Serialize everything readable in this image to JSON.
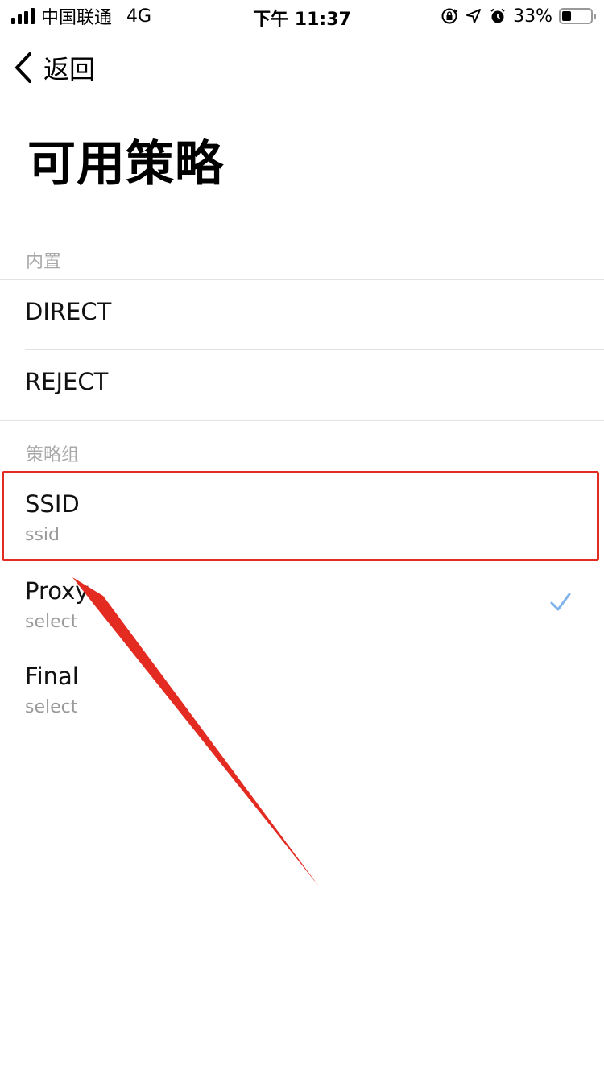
{
  "status_bar": {
    "carrier": "中国联通",
    "network": "4G",
    "time": "下午 11:37",
    "battery_percent": "33%",
    "battery_level": 0.33,
    "icons": [
      "orientation-lock-icon",
      "location-icon",
      "alarm-icon"
    ]
  },
  "nav": {
    "back_label": "返回"
  },
  "page": {
    "title": "可用策略"
  },
  "sections": [
    {
      "header": "内置",
      "items": [
        {
          "title": "DIRECT"
        },
        {
          "title": "REJECT"
        }
      ]
    },
    {
      "header": "策略组",
      "items": [
        {
          "title": "SSID",
          "subtitle": "ssid",
          "highlighted": true
        },
        {
          "title": "Proxy",
          "subtitle": "select",
          "selected": true
        },
        {
          "title": "Final",
          "subtitle": "select"
        }
      ]
    }
  ],
  "colors": {
    "accent_check": "#7fb2ea",
    "annotation": "#e32b22",
    "secondary_text": "#9a9a9a",
    "divider": "#e2e2e2"
  }
}
